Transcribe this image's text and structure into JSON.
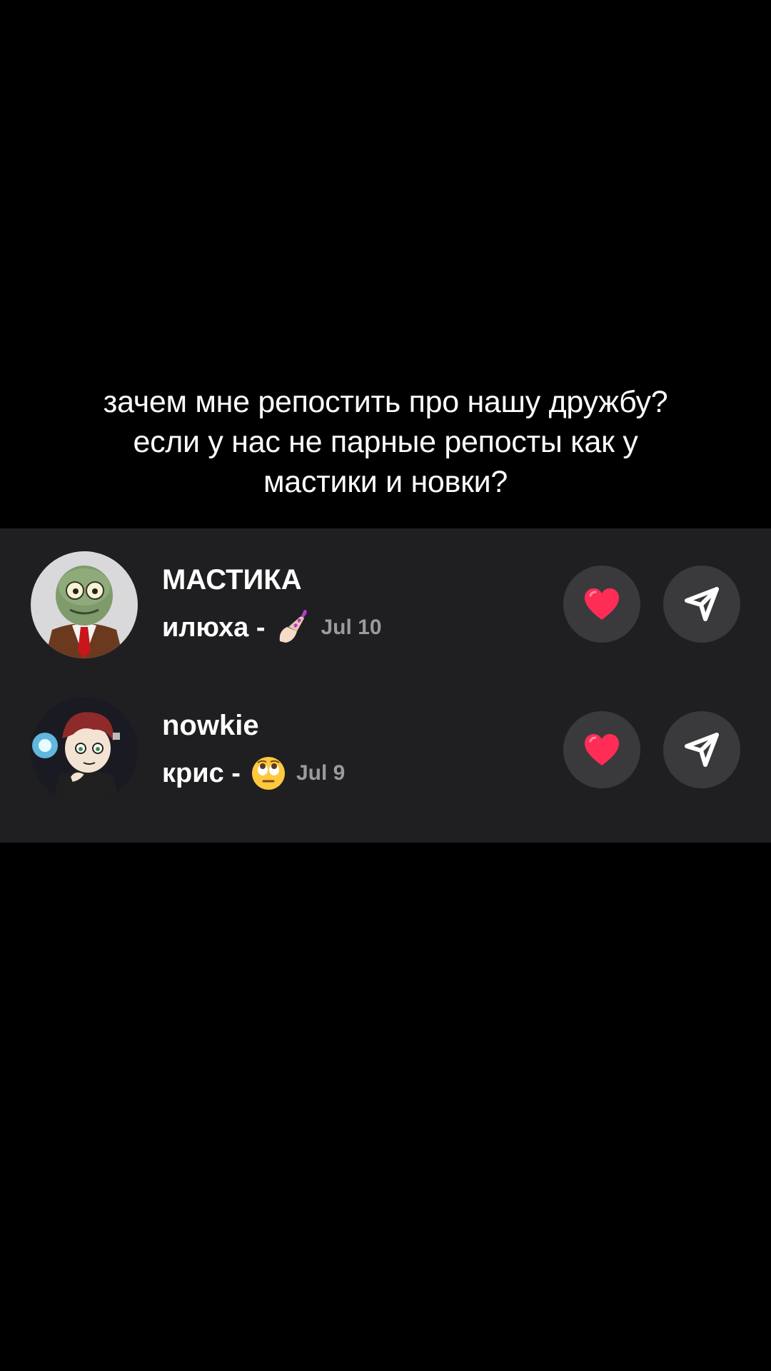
{
  "caption": {
    "line1": "зачем мне репостить про нашу дружбу?",
    "line2": "если у нас не парные репосты как у",
    "line3": "мастики и новки?"
  },
  "repost_list": [
    {
      "name": "МАСТИКА",
      "subtext": "илюха -",
      "emoji": "nail-polish-emoji",
      "date": "Jul 10",
      "avatar": "green-zombie-cartoon-avatar"
    },
    {
      "name": "nowkie",
      "subtext": "крис -",
      "emoji": "face-with-rolling-eyes-emoji",
      "date": "Jul 9",
      "avatar": "cartoon-boy-red-hair-avatar"
    }
  ],
  "actions": {
    "like_icon": "heart-icon",
    "share_icon": "send-icon"
  },
  "colors": {
    "background": "#000000",
    "panel": "#1f1f22",
    "button": "#3a3a3d",
    "heart": "#ff2d55",
    "date": "#9a9aa0",
    "text": "#ffffff"
  }
}
